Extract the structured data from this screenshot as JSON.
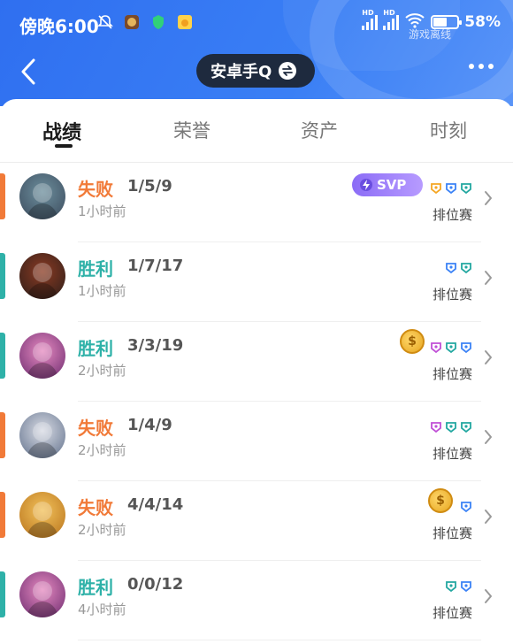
{
  "status": {
    "time": "傍晚6:00",
    "battery_pct": "58%",
    "battery_level": 0.58,
    "offline_label": "游戏离线",
    "hd1": "HD",
    "hd2": "HD"
  },
  "header": {
    "title": "安卓手Q",
    "back_icon": "chevron-left-icon",
    "more_icon": "more-icon"
  },
  "tabs": [
    {
      "label": "战绩",
      "active": true
    },
    {
      "label": "荣誉",
      "active": false
    },
    {
      "label": "资产",
      "active": false
    },
    {
      "label": "时刻",
      "active": false
    }
  ],
  "matches": [
    {
      "result": "失败",
      "kda": "1/5/9",
      "time": "1小时前",
      "mode": "排位赛",
      "outcome": "lose",
      "extra": "svp",
      "svp_label": "SVP",
      "badges": [
        "#f5a623",
        "#3b82f6",
        "#22a7a0"
      ]
    },
    {
      "result": "胜利",
      "kda": "1/7/17",
      "time": "1小时前",
      "mode": "排位赛",
      "outcome": "win",
      "extra": "",
      "badges": [
        "#3b82f6",
        "#22a7a0"
      ]
    },
    {
      "result": "胜利",
      "kda": "3/3/19",
      "time": "2小时前",
      "mode": "排位赛",
      "outcome": "win",
      "extra": "coin",
      "badges": [
        "#c04fd6",
        "#22a7a0",
        "#3b82f6"
      ]
    },
    {
      "result": "失败",
      "kda": "1/4/9",
      "time": "2小时前",
      "mode": "排位赛",
      "outcome": "lose",
      "extra": "",
      "badges": [
        "#c04fd6",
        "#22a7a0",
        "#22a7a0"
      ]
    },
    {
      "result": "失败",
      "kda": "4/4/14",
      "time": "2小时前",
      "mode": "排位赛",
      "outcome": "lose",
      "extra": "coin",
      "badges": [
        "#3b82f6"
      ]
    },
    {
      "result": "胜利",
      "kda": "0/0/12",
      "time": "4小时前",
      "mode": "排位赛",
      "outcome": "win",
      "extra": "",
      "badges": [
        "#22a7a0",
        "#3b82f6"
      ]
    }
  ],
  "colors": {
    "header": "#2f6ff0",
    "win": "#2eb1a8",
    "lose": "#f17a38"
  }
}
